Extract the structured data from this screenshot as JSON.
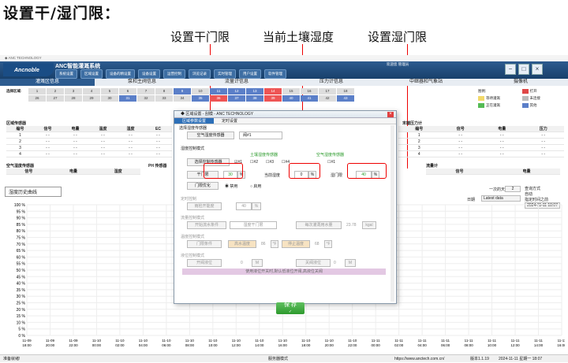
{
  "annotation": {
    "headline": "设置干/湿门限：",
    "note_dry": "设置干门限",
    "note_moisture": "当前土壤湿度",
    "note_wet": "设置湿门限"
  },
  "app": {
    "window_title": "◆ ANC TECHNOLOGY",
    "logo": "Ancnoble",
    "system_name": "ANC智能灌溉系统",
    "menu": [
      "系统设置",
      "区域设置",
      "设备的精设置",
      "设备设置",
      "运营控制",
      "浏览记录",
      "实时管理",
      "用户设置",
      "软件管理"
    ],
    "header_right": "欢迎您 管理员"
  },
  "tabs": [
    "灌溉区信息",
    "泵和主阀信息",
    "流量计信息",
    "压力计信息",
    "中继器和气象站",
    "摄像机"
  ],
  "nodes": {
    "label": "选择区域:",
    "row1": [
      "1",
      "2",
      "3",
      "4",
      "5",
      "6",
      "7",
      "8",
      "9",
      "10",
      "11",
      "12",
      "13",
      "14",
      "15",
      "16",
      "17",
      "18"
    ],
    "row2": [
      "26",
      "27",
      "28",
      "29",
      "30",
      "31",
      "32",
      "33",
      "34",
      "35",
      "36",
      "37",
      "38",
      "39",
      "40",
      "41",
      "42",
      "43"
    ]
  },
  "legend": {
    "title": "图例:",
    "items": [
      "打开",
      "等待灌溉",
      "未连接",
      "正在灌溉",
      "其他"
    ],
    "colors": [
      "#e04848",
      "#f2d96a",
      "#bbbbbb",
      "#55bb55",
      "#5b7fc8"
    ]
  },
  "sensors": {
    "title": "区域传感器",
    "cols": [
      "编号",
      "信号",
      "电量",
      "温度",
      "湿度",
      "EC"
    ],
    "rows": [
      [
        "1",
        "- -",
        "- -",
        "- -",
        "- -",
        "- -"
      ],
      [
        "2",
        "- -",
        "- -",
        "- -",
        "- -",
        "- -"
      ],
      [
        "3",
        "- -",
        "- -",
        "- -",
        "- -",
        "- -"
      ],
      [
        "4",
        "- -",
        "- -",
        "- -",
        "- -",
        "- -"
      ]
    ]
  },
  "pressure": {
    "title": "末端压力计",
    "cols": [
      "编号",
      "信号",
      "电量",
      "压力"
    ],
    "rows": [
      [
        "1",
        "- -",
        "- -",
        "- -"
      ],
      [
        "2",
        "- -",
        "- -",
        "- -"
      ],
      [
        "3",
        "- -",
        "- -",
        "- -"
      ],
      [
        "4",
        "- -",
        "- -",
        "- -"
      ]
    ]
  },
  "air": {
    "title": "空气湿度传感器",
    "cols": [
      "信号",
      "电量",
      "湿度"
    ]
  },
  "ph": {
    "title": "PH 传感器",
    "cols": [
      "信号",
      "电量",
      "PH"
    ]
  },
  "flow": {
    "title": "流量计",
    "cols": [
      "信号",
      "电量"
    ]
  },
  "history": {
    "select": "湿度历史曲线",
    "range_label": "一次的天数",
    "range_value": "2",
    "date_label": "日期",
    "date_value": "Latest data",
    "query_label": "查询方式",
    "auto": "自动",
    "manual": "指定时间之前",
    "date_input": "2024-11-11 18:07",
    "y_ticks": [
      "100 %",
      "95 %",
      "90 %",
      "85 %",
      "80 %",
      "75 %",
      "70 %",
      "65 %",
      "60 %",
      "55 %",
      "50 %",
      "45 %",
      "40 %",
      "35 %",
      "30 %",
      "25 %",
      "20 %",
      "15 %",
      "10 %",
      "5 %",
      "0 %"
    ],
    "x_ticks": [
      "11-09\n18:00",
      "11-09\n20:00",
      "11-09\n22:00",
      "11-10\n00:00",
      "11-10\n02:00",
      "11-10\n04:00",
      "11-10\n06:00",
      "11-10\n08:00",
      "11-10\n10:00",
      "11-10\n12:00",
      "11-10\n14:00",
      "11-10\n16:00",
      "11-10\n18:00",
      "11-10\n20:00",
      "11-10\n22:00",
      "11-11\n00:00",
      "11-11\n02:00",
      "11-11\n04:00",
      "11-11\n06:00",
      "11-11\n08:00",
      "11-11\n10:00",
      "11-11\n12:00",
      "11-11\n14:00",
      "11-11\n16:00"
    ]
  },
  "dialog": {
    "title": "◆ 区域设置 - 刮模 - ANC TECHNOLOGY",
    "tabs": [
      "区域参数设置",
      "定时设置"
    ],
    "sensor_type_label": "选择湿度传感器",
    "sensor_type": "空气湿度传感器",
    "sensor_select": "阀#1",
    "mode_label": "湿度控制模式",
    "soil_sensor_label": "土壤湿度传感器",
    "air_sensor_label": "空气湿度传感器",
    "choose_sensor_btn": "选择控制传感器",
    "checks": [
      "#1",
      "#2",
      "#3",
      "#4"
    ],
    "air_check": "#1",
    "dry_label": "干门限",
    "dry_value": "30",
    "current_label": "当前湿度",
    "current_value": "0",
    "wet_label": "湿门限",
    "wet_value": "40",
    "pct": "%",
    "door_opt_btn": "门限优化",
    "disable": "禁用",
    "enable": "启用",
    "timing_title": "定时控制",
    "timing_label": "雨检开能度",
    "timing_value": "40",
    "rain_title": "流量控制模式",
    "rain_btn": "开始流水条件",
    "rain_field": "湿度干门限",
    "volume_label": "每次灌溉用水量",
    "volume_value": "23.78",
    "volume_unit": "kgal",
    "temp_title": "温度控制模式",
    "temp_btn": "门限条件",
    "temp_start": "高水温度",
    "temp_start_val": "86",
    "temp_unit": "°F",
    "temp_stop": "停止温度",
    "temp_stop_val": "68",
    "level_title": "液位控制模式",
    "level_on": "开阀液位",
    "level_on_val": "0",
    "level_unit": "M",
    "level_off": "关阀液位",
    "level_off_val": "0",
    "level_note": "使用液位开关时,默认低液位开阀,高液位关阀",
    "save": "保 存"
  },
  "status": {
    "left": "准备就绪!",
    "mid": "服务器模式",
    "url": "https://www.anctech.com.cn/",
    "version": "版本1.1.19",
    "datetime": "2024-11-11  星期一  18:07"
  }
}
